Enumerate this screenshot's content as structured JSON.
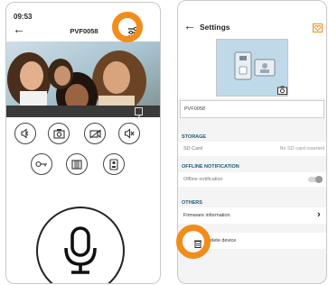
{
  "left_screen": {
    "status_time": "09:53",
    "title": "PVF0058",
    "icons": {
      "back": "back-arrow-icon",
      "settings": "sliders-icon",
      "fullscreen": "fullscreen-icon"
    },
    "controls_row1": [
      "volume-off-icon",
      "camera-icon",
      "video-record-icon",
      "speaker-mute-icon"
    ],
    "controls_row2": [
      "key-icon",
      "barrier-gate-icon",
      "intercom-icon"
    ],
    "mic": "microphone-icon"
  },
  "right_screen": {
    "title": "Settings",
    "device_name": "PVF0058",
    "sections": {
      "storage": {
        "label": "STORAGE",
        "row_label": "SD Card",
        "row_value": "No SD card inserted"
      },
      "offline": {
        "label": "OFFLINE NOTIFICATION",
        "row_label": "Offline notification",
        "toggle_on": false
      },
      "others": {
        "label": "OTHERS",
        "firmware_label": "Firmware information",
        "delete_label": "Delete device"
      }
    }
  },
  "colors": {
    "accent_orange": "#f28c1b",
    "section_blue": "#1e5a78",
    "device_card": "#bfd9e8"
  }
}
